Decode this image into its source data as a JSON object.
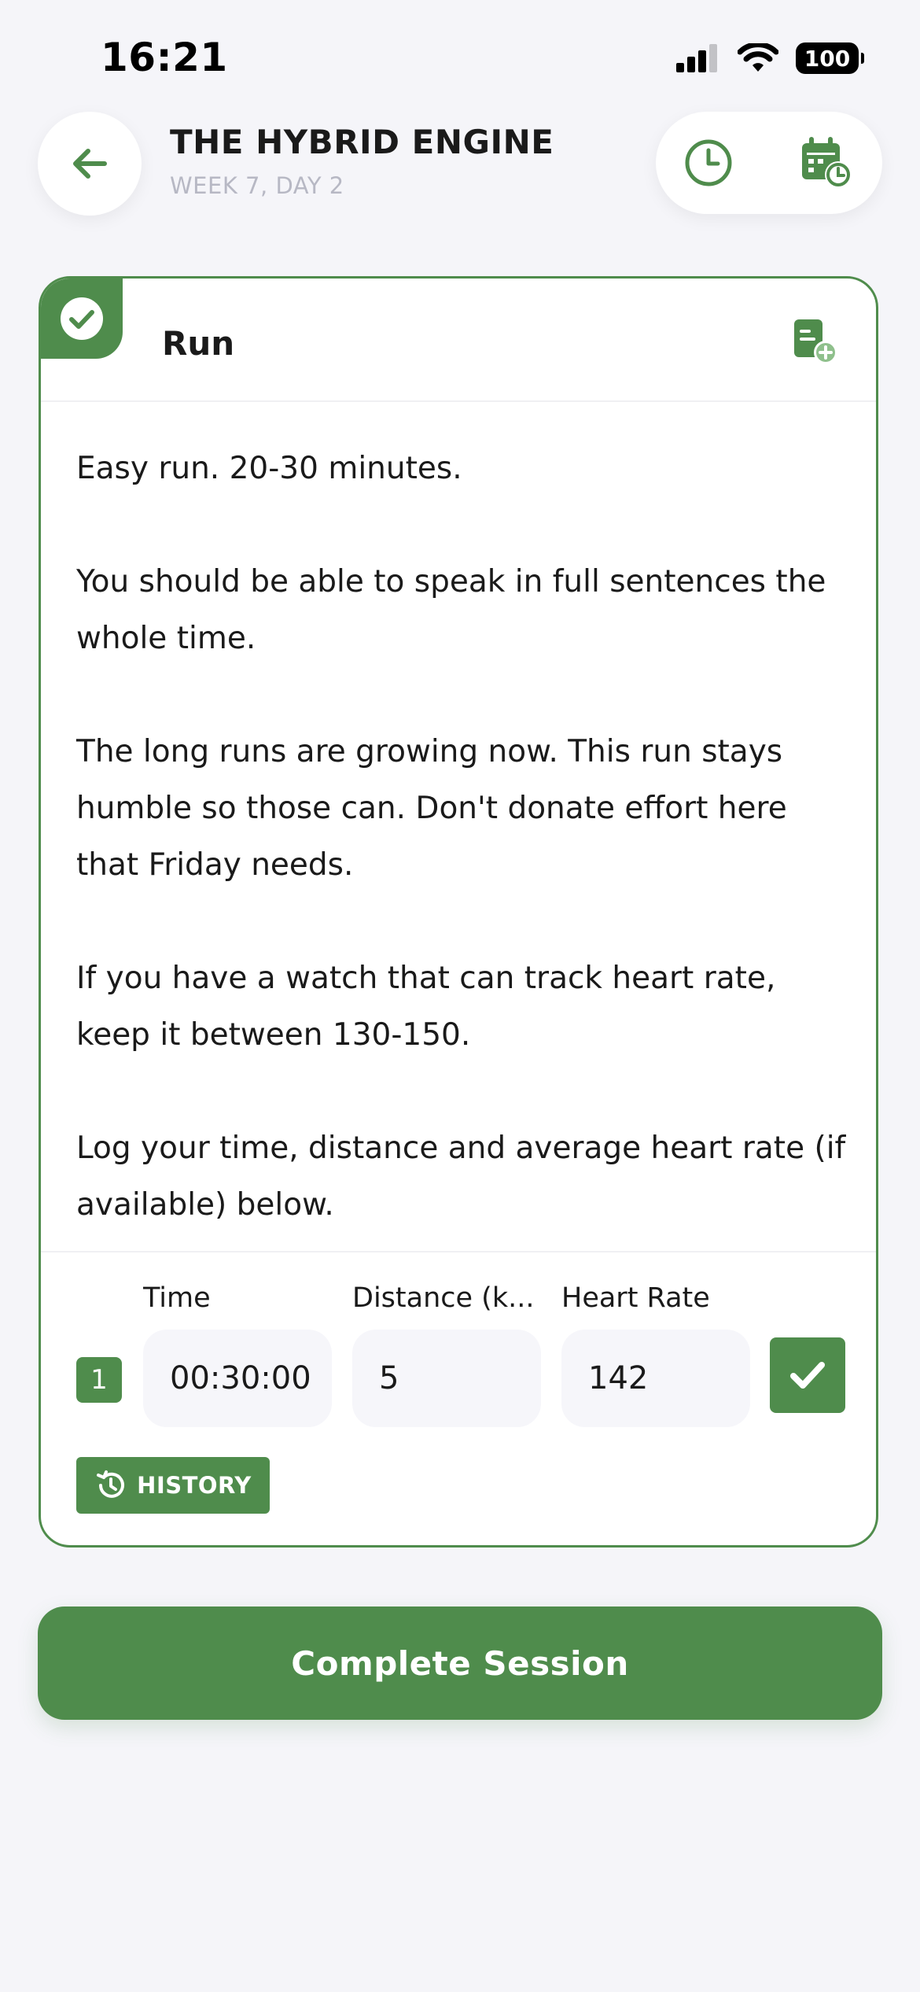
{
  "status_bar": {
    "time": "16:21",
    "battery": "100",
    "icons": [
      "cellular-signal-icon",
      "wifi-icon",
      "battery-icon"
    ]
  },
  "header": {
    "title": "THE HYBRID ENGINE",
    "subtitle": "WEEK 7, DAY 2",
    "icons": [
      "arrow-left-icon",
      "clock-icon",
      "calendar-clock-icon"
    ]
  },
  "exercise": {
    "title": "Run",
    "completed": true,
    "description": [
      "Easy run. 20-30 minutes.",
      "You should be able to speak in full sentences the whole time.",
      "The long runs are growing now. This run stays humble so those can. Don't donate effort here that Friday needs.",
      "If you have a watch that can track heart rate, keep it between 130-150.",
      "Log your time, distance and average heart rate (if available) below."
    ],
    "columns": [
      "Time",
      "Distance (k...",
      "Heart Rate"
    ],
    "sets": [
      {
        "number": "1",
        "time": "00:30:00",
        "distance": "5",
        "heart_rate": "142",
        "done": true
      }
    ],
    "history_label": "HISTORY"
  },
  "complete_session_label": "Complete Session",
  "colors": {
    "accent": "#4f8c4c",
    "background": "#f5f5f9",
    "field": "#f6f6fa",
    "muted": "#b7b8c4"
  }
}
